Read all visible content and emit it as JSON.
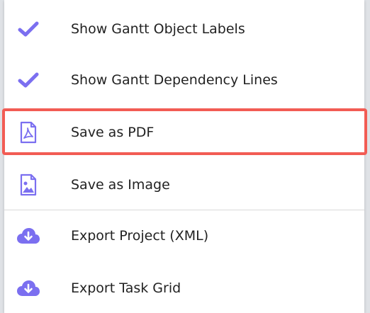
{
  "menu": {
    "items": [
      {
        "label": "Show Gantt Object Labels",
        "icon": "checkmark-icon"
      },
      {
        "label": "Show Gantt Dependency Lines",
        "icon": "checkmark-icon"
      },
      {
        "label": "Save as PDF",
        "icon": "pdf-file-icon"
      },
      {
        "label": "Save as Image",
        "icon": "image-file-icon"
      },
      {
        "label": "Export Project (XML)",
        "icon": "cloud-download-icon"
      },
      {
        "label": "Export Task Grid",
        "icon": "cloud-download-icon"
      }
    ],
    "highlighted_item": "Save as PDF"
  },
  "colors": {
    "icon": "#7b6ff0",
    "highlight": "#f25c54",
    "text": "#222222"
  }
}
